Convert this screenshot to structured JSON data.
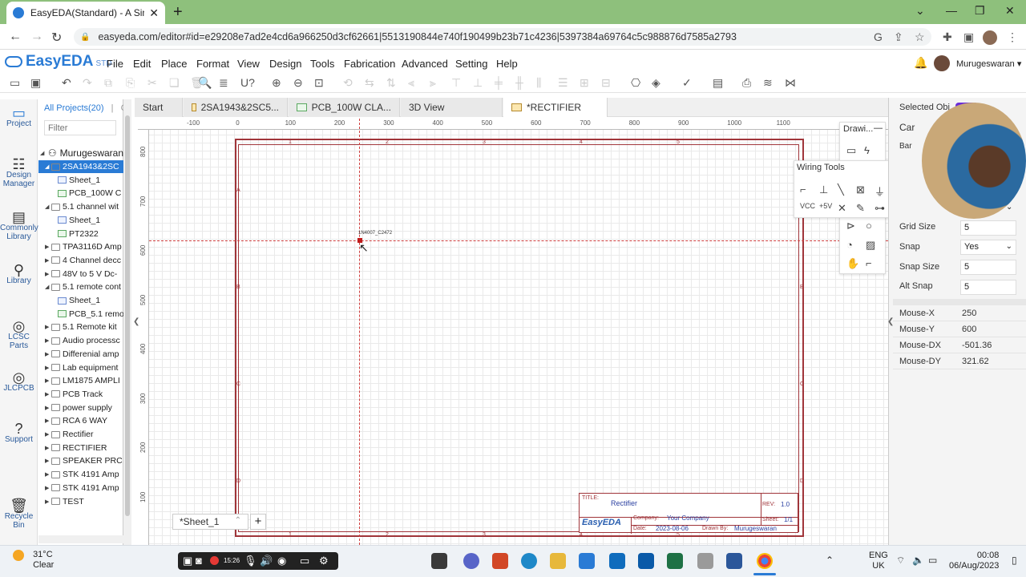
{
  "browser": {
    "tab_title": "EasyEDA(Standard) - A Simple an",
    "url": "easyeda.com/editor#id=e29208e7ad2e4cd6a966250d3cf62661|5513190844e740f190499b23b71c4236|5397384a69764c5c988876d7585a2793",
    "new_tab": "+",
    "close_tab": "✕"
  },
  "app": {
    "logo": "EasyEDA",
    "logo_suffix": "STD",
    "menu": [
      "File",
      "Edit",
      "Place",
      "Format",
      "View",
      "Design",
      "Tools",
      "Fabrication",
      "Advanced",
      "Setting",
      "Help"
    ],
    "user": "Murugeswaran ▾"
  },
  "rail": [
    {
      "label": "Project",
      "icon": "folder-icon"
    },
    {
      "label": "Design Manager",
      "icon": "design-manager-icon"
    },
    {
      "label": "Commonly Library",
      "icon": "common-library-icon"
    },
    {
      "label": "Library",
      "icon": "library-icon"
    },
    {
      "label": "LCSC Parts",
      "icon": "lcsc-icon"
    },
    {
      "label": "JLCPCB",
      "icon": "jlcpcb-icon"
    },
    {
      "label": "Support",
      "icon": "help-icon"
    },
    {
      "label": "Recycle Bin",
      "icon": "trash-icon"
    }
  ],
  "tree": {
    "header": "All Projects(20)",
    "header_sep": "|",
    "header_c": "C",
    "filter_placeholder": "Filter",
    "root": "Murugeswaran",
    "items": [
      {
        "label": "2SA1943&2SC",
        "type": "folder",
        "level": 1,
        "selected": true,
        "arrow": "◢"
      },
      {
        "label": "Sheet_1",
        "type": "sch",
        "level": 2
      },
      {
        "label": "PCB_100W C",
        "type": "pcb",
        "level": 2
      },
      {
        "label": "5.1 channel wit",
        "type": "folder",
        "level": 1,
        "arrow": "◢"
      },
      {
        "label": "Sheet_1",
        "type": "sch",
        "level": 2
      },
      {
        "label": "PT2322",
        "type": "pcb",
        "level": 2
      },
      {
        "label": "TPA3116D Amp",
        "type": "folder",
        "level": 1,
        "arrow": "▶"
      },
      {
        "label": "4 Channel decc",
        "type": "folder",
        "level": 1,
        "arrow": "▶"
      },
      {
        "label": "48V to 5 V Dc-",
        "type": "folder",
        "level": 1,
        "arrow": "▶"
      },
      {
        "label": "5.1 remote cont",
        "type": "folder",
        "level": 1,
        "arrow": "◢"
      },
      {
        "label": "Sheet_1",
        "type": "sch",
        "level": 2
      },
      {
        "label": "PCB_5.1 remo",
        "type": "pcb",
        "level": 2
      },
      {
        "label": "5.1 Remote kit",
        "type": "folder",
        "level": 1,
        "arrow": "▶"
      },
      {
        "label": "Audio processc",
        "type": "folder",
        "level": 1,
        "arrow": "▶"
      },
      {
        "label": "Differenial amp",
        "type": "folder",
        "level": 1,
        "arrow": "▶"
      },
      {
        "label": "Lab equipment",
        "type": "folder",
        "level": 1,
        "arrow": "▶"
      },
      {
        "label": "LM1875 AMPLI",
        "type": "folder",
        "level": 1,
        "arrow": "▶"
      },
      {
        "label": "PCB Track",
        "type": "folder",
        "level": 1,
        "arrow": "▶"
      },
      {
        "label": "power supply",
        "type": "folder",
        "level": 1,
        "arrow": "▶"
      },
      {
        "label": "RCA 6 WAY",
        "type": "folder",
        "level": 1,
        "arrow": "▶"
      },
      {
        "label": "Rectifier",
        "type": "folder",
        "level": 1,
        "arrow": "▶"
      },
      {
        "label": "RECTIFIER",
        "type": "folder",
        "level": 1,
        "arrow": "▶"
      },
      {
        "label": "SPEAKER PRC",
        "type": "folder",
        "level": 1,
        "arrow": "▶"
      },
      {
        "label": "STK 4191 Amp",
        "type": "folder",
        "level": 1,
        "arrow": "▶"
      },
      {
        "label": "STK 4191 Amp",
        "type": "folder",
        "level": 1,
        "arrow": "▶"
      },
      {
        "label": "TEST",
        "type": "folder",
        "level": 1,
        "arrow": "▶"
      }
    ]
  },
  "doc_tabs": [
    {
      "label": "Start",
      "type": "none"
    },
    {
      "label": "2SA1943&2SC5...",
      "type": "folder"
    },
    {
      "label": "PCB_100W CLA...",
      "type": "pcb"
    },
    {
      "label": "3D View",
      "type": "none"
    },
    {
      "label": "*RECTIFIER",
      "type": "folder",
      "active": true
    }
  ],
  "rulers": {
    "top": [
      "-100",
      "0",
      "100",
      "200",
      "300",
      "400",
      "500",
      "600",
      "700",
      "800",
      "900",
      "1000",
      "1100"
    ],
    "left": [
      "800",
      "700",
      "600",
      "500",
      "400",
      "300",
      "200",
      "100"
    ]
  },
  "frame": {
    "cols": [
      "1",
      "2",
      "3",
      "4",
      "5"
    ],
    "rows": [
      "A",
      "B",
      "C",
      "D"
    ]
  },
  "part_label": "1N4007_C2472",
  "title_block": {
    "title_label": "TITLE:",
    "title": "Rectifier",
    "rev_label": "REV:",
    "rev": "1.0",
    "company_label": "Company:",
    "company": "Your Company",
    "sheet_label": "Sheet:",
    "sheet": "1/1",
    "logo": "EasyEDA",
    "date_label": "Date:",
    "date": "2023-08-06",
    "drawn_label": "Drawn By:",
    "drawn": "Murugeswaran"
  },
  "sheet_tab": "*Sheet_1",
  "sheet_tab_arrow": "⌃",
  "sheet_add": "+",
  "drawing_tools": {
    "title": "Drawi...",
    "min": "—"
  },
  "wiring_tools": {
    "title": "Wiring Tools"
  },
  "right_panel": {
    "selected": "Selected Obj",
    "selected_badge": "•••",
    "can": "Car",
    "bar": "Bar",
    "grid_size_label": "Grid Size",
    "grid_size": "5",
    "snap_label": "Snap",
    "snap": "Yes",
    "snap_size_label": "Snap Size",
    "snap_size": "5",
    "alt_snap_label": "Alt Snap",
    "alt_snap": "5",
    "mouse": [
      {
        "label": "Mouse-X",
        "value": "250"
      },
      {
        "label": "Mouse-Y",
        "value": "600"
      },
      {
        "label": "Mouse-DX",
        "value": "-501.36"
      },
      {
        "label": "Mouse-DY",
        "value": "321.62"
      }
    ]
  },
  "taskbar": {
    "temp": "31°C",
    "weather": "Clear",
    "rec_time": "15:26",
    "lang1": "ENG",
    "lang2": "UK",
    "time": "00:08",
    "date": "06/Aug/2023"
  }
}
